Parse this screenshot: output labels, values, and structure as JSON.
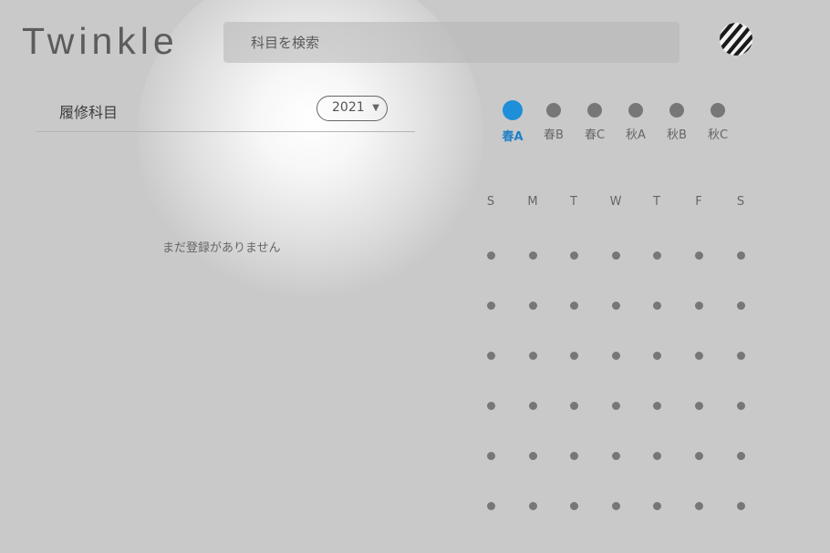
{
  "app": {
    "logo": "Twinkle"
  },
  "search": {
    "placeholder": "科目を検索"
  },
  "courses": {
    "title": "履修科目",
    "year": "2021",
    "empty_message": "まだ登録がありません"
  },
  "modules": [
    {
      "label": "春A",
      "active": true
    },
    {
      "label": "春B",
      "active": false
    },
    {
      "label": "春C",
      "active": false
    },
    {
      "label": "秋A",
      "active": false
    },
    {
      "label": "秋B",
      "active": false
    },
    {
      "label": "秋C",
      "active": false
    }
  ],
  "weekdays": [
    "S",
    "M",
    "T",
    "W",
    "T",
    "F",
    "S"
  ],
  "timetable": {
    "periods": 6
  },
  "colors": {
    "accent": "#1e8fd8",
    "background": "#c9c9c9",
    "slot": "#777777"
  }
}
